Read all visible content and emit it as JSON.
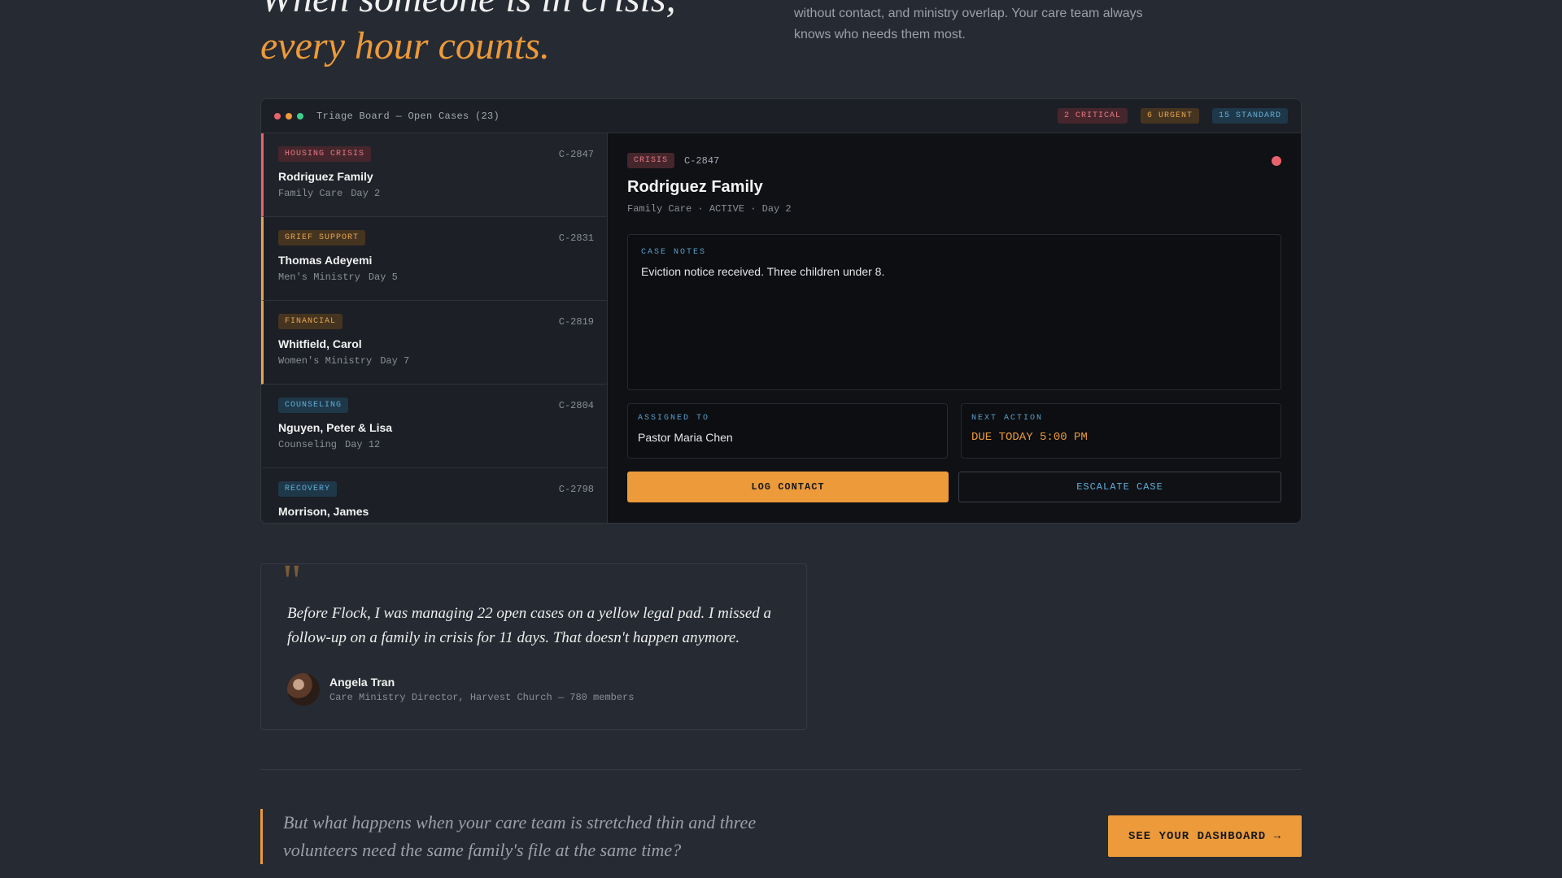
{
  "hero": {
    "title_line1": "When someone is in crisis,",
    "title_line2": "every hour counts.",
    "copy": "without contact, and ministry overlap. Your care team always knows who needs them most."
  },
  "window": {
    "title": "Triage Board — Open Cases (23)",
    "dot_colors": [
      "#e8636c",
      "#ec9a3a",
      "#3ecf8e"
    ],
    "counts": {
      "critical": "2 CRITICAL",
      "urgent": "6 URGENT",
      "standard": "15 STANDARD"
    }
  },
  "cases": [
    {
      "tag": "HOUSING CRISIS",
      "id": "C-2847",
      "name": "Rodriguez Family",
      "ministry": "Family Care",
      "day": "Day 2",
      "severity": "critical"
    },
    {
      "tag": "GRIEF SUPPORT",
      "id": "C-2831",
      "name": "Thomas Adeyemi",
      "ministry": "Men's Ministry",
      "day": "Day 5",
      "severity": "urgent"
    },
    {
      "tag": "FINANCIAL",
      "id": "C-2819",
      "name": "Whitfield, Carol",
      "ministry": "Women's Ministry",
      "day": "Day 7",
      "severity": "urgent"
    },
    {
      "tag": "COUNSELING",
      "id": "C-2804",
      "name": "Nguyen, Peter & Lisa",
      "ministry": "Counseling",
      "day": "Day 12",
      "severity": "standard"
    },
    {
      "tag": "RECOVERY",
      "id": "C-2798",
      "name": "Morrison, James",
      "ministry": "",
      "day": "",
      "severity": "standard"
    }
  ],
  "detail": {
    "tag": "CRISIS",
    "id": "C-2847",
    "name": "Rodriguez Family",
    "meta": "Family Care · ACTIVE · Day 2",
    "notes_label": "CASE NOTES",
    "notes": "Eviction notice received. Three children under 8.",
    "assigned_label": "ASSIGNED TO",
    "assigned": "Pastor Maria Chen",
    "next_label": "NEXT ACTION",
    "next": "DUE TODAY 5:00 PM",
    "log_label": "LOG CONTACT",
    "escalate_label": "ESCALATE CASE"
  },
  "testimonial": {
    "mark": "\"",
    "quote": "Before Flock, I was managing 22 open cases on a yellow legal pad. I missed a follow-up on a family in crisis for 11 days. That doesn't happen anymore.",
    "author": "Angela Tran",
    "role": "Care Ministry Director, Harvest Church — 780 members"
  },
  "bottom": {
    "quote": "But what happens when your care team is stretched thin and three volunteers need the same family's file at the same time?",
    "cta": "SEE YOUR DASHBOARD →"
  },
  "colors": {
    "accent": "#ec9a3a",
    "critical": "#e8636c",
    "urgent": "#e6a552",
    "standard": "#62aed8"
  }
}
